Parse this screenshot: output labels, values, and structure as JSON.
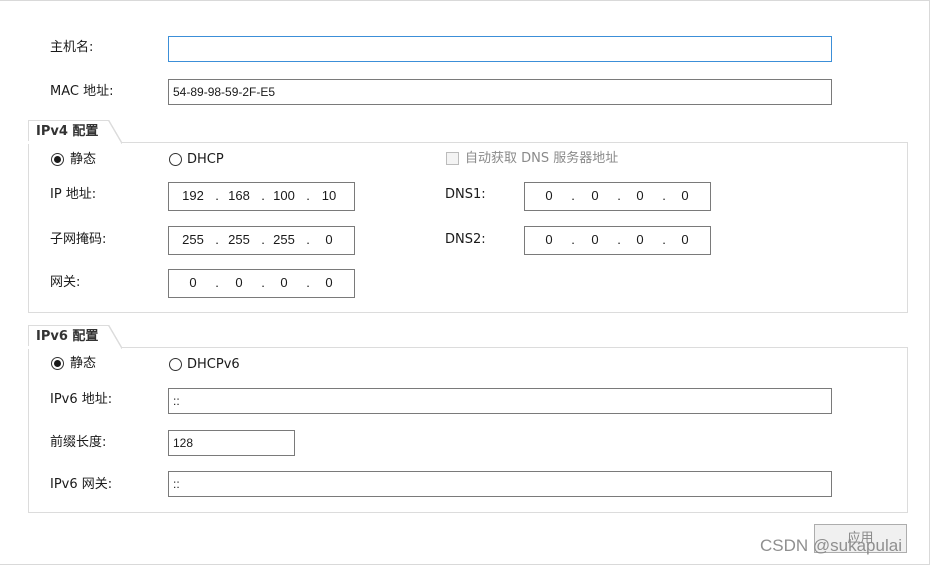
{
  "general": {
    "hostname_label": "主机名:",
    "hostname_value": "",
    "mac_label": "MAC 地址:",
    "mac_value": "54-89-98-59-2F-E5"
  },
  "ipv4": {
    "title": "IPv4 配置",
    "static_label": "静态",
    "dhcp_label": "DHCP",
    "mode": "static",
    "auto_dns_label": "自动获取 DNS 服务器地址",
    "auto_dns_checked": false,
    "ip_label": "IP 地址:",
    "ip": [
      "192",
      "168",
      "100",
      "10"
    ],
    "mask_label": "子网掩码:",
    "mask": [
      "255",
      "255",
      "255",
      "0"
    ],
    "gateway_label": "网关:",
    "gateway": [
      "0",
      "0",
      "0",
      "0"
    ],
    "dns1_label": "DNS1:",
    "dns1": [
      "0",
      "0",
      "0",
      "0"
    ],
    "dns2_label": "DNS2:",
    "dns2": [
      "0",
      "0",
      "0",
      "0"
    ]
  },
  "ipv6": {
    "title": "IPv6 配置",
    "static_label": "静态",
    "dhcpv6_label": "DHCPv6",
    "mode": "static",
    "address_label": "IPv6 地址:",
    "address_value": "::",
    "prefix_label": "前缀长度:",
    "prefix_value": "128",
    "gateway_label": "IPv6 网关:",
    "gateway_value": "::"
  },
  "actions": {
    "apply_label": "应用"
  },
  "watermark": "CSDN @sukapulai"
}
